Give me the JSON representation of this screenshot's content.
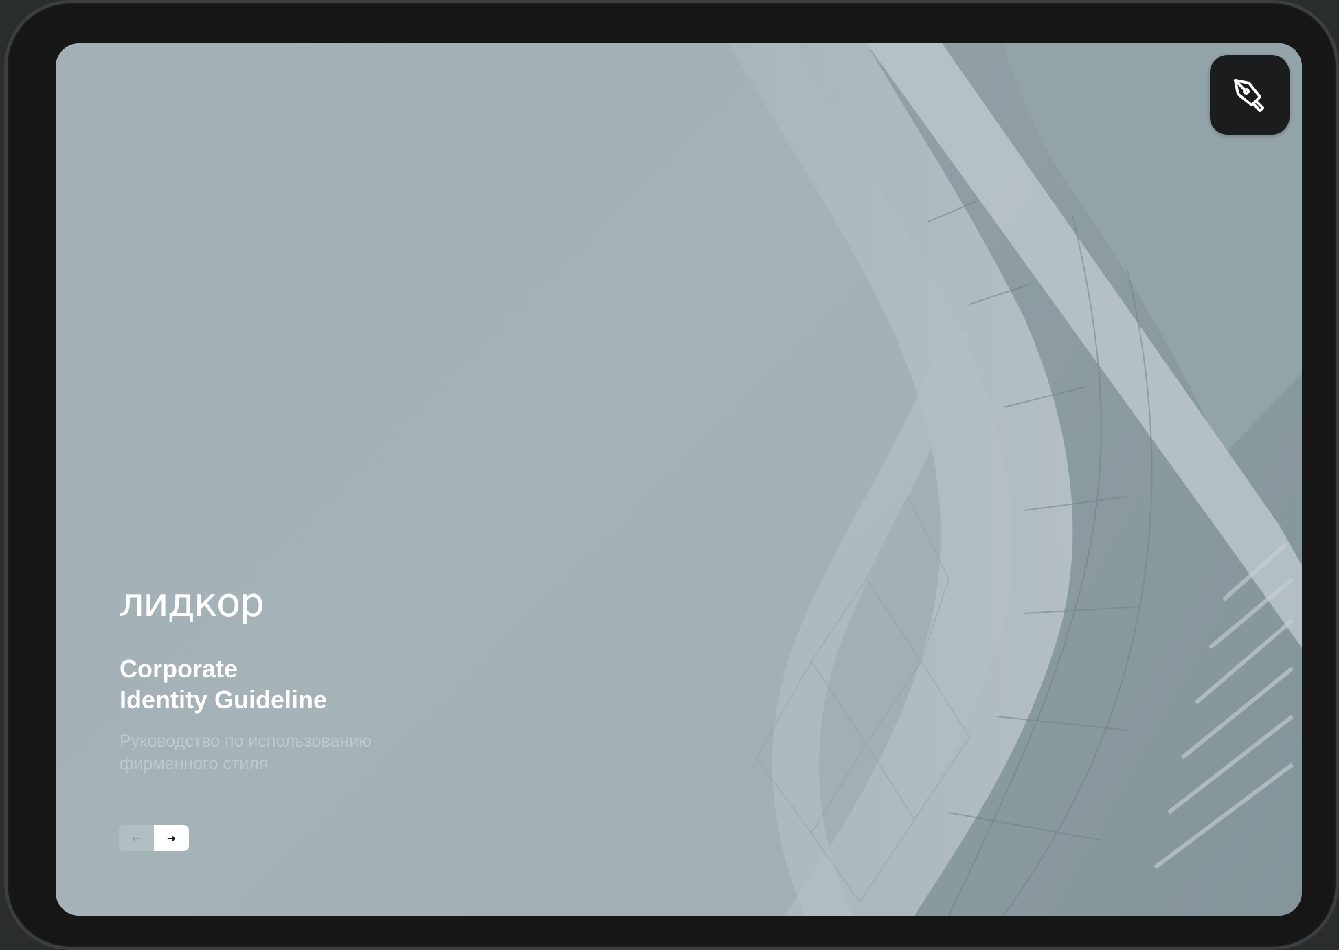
{
  "brand": {
    "logo_text": "лидкор"
  },
  "cover": {
    "title_line1": "Corporate",
    "title_line2": "Identity Guideline",
    "subtitle_line1": "Руководство по использованию",
    "subtitle_line2": "фирменного стиля"
  },
  "navigation": {
    "prev_icon": "←",
    "next_icon": "➜"
  },
  "toolbar": {
    "pen_icon": "pen-tool-icon"
  },
  "colors": {
    "screen_background": "#a3b0b6",
    "pen_button": "#1b1c1d",
    "text_primary": "#ffffff",
    "text_secondary": "#bfc9cd"
  }
}
